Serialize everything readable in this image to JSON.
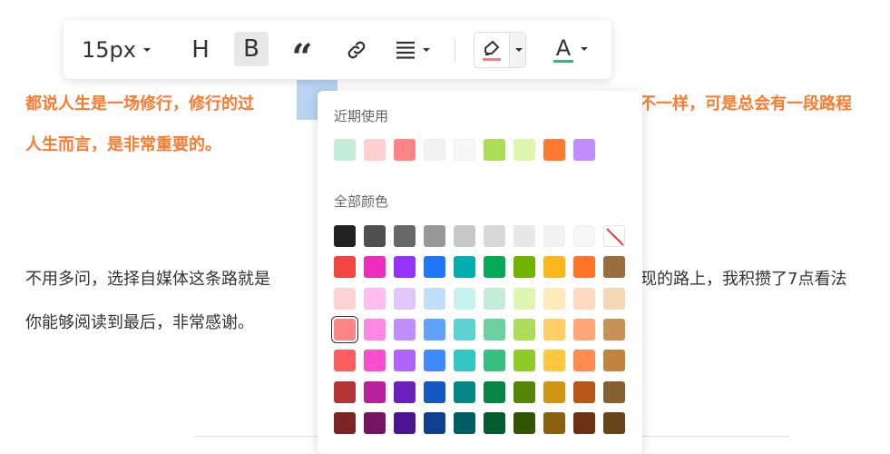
{
  "editor": {
    "heading_line1_left": "都说人生是一场修行，修行的过",
    "heading_line1_right": "不一样，可是总会有一段路程",
    "heading_line2": "人生而言，是非常重要的。",
    "body_line1_left": "不用多问，选择自媒体这条路就是",
    "body_line1_right": "现的路上，我积攒了7点看法",
    "body_line2": "你能够阅读到最后，非常感谢。",
    "heading_color": "#ff7a2f"
  },
  "toolbar": {
    "font_size": "15px",
    "heading": "H",
    "bold": "B",
    "font_color_letter": "A",
    "highlight_underline_color": "#f08080",
    "font_color_underline": "#3cb371"
  },
  "color_picker": {
    "recent_label": "近期使用",
    "all_label": "全部颜色",
    "recent": [
      "#c3ecd9",
      "#ffd0d0",
      "#ff8585",
      "#f2f2f2",
      "#f7f7f7",
      "#acdd58",
      "#def6ae",
      "#ff7a2f",
      "#c18cfc"
    ],
    "selected": "#ff8585",
    "rows": [
      [
        "#222222",
        "#4f4f4f",
        "#686868",
        "#999999",
        "#c7c7c7",
        "#d8d8d8",
        "#e8e8e8",
        "#f2f2f2",
        "#f7f7f7",
        "none"
      ],
      [
        "#f34444",
        "#ec2dbd",
        "#9632fc",
        "#1f76fb",
        "#03aeb0",
        "#04aa56",
        "#72b300",
        "#feb71a",
        "#ff7429",
        "#9a6d3e"
      ],
      [
        "#ffd3d3",
        "#ffbcef",
        "#e2c7ff",
        "#c1dff6",
        "#c8f2f0",
        "#c4ecd9",
        "#def6b2",
        "#feeabb",
        "#fed9c2",
        "#f4d8b5"
      ],
      [
        "#ff8585",
        "#fe88e4",
        "#c18cfc",
        "#5ea1ff",
        "#5dd2d3",
        "#6dd09f",
        "#acdd58",
        "#fed063",
        "#ffa676",
        "#c89257"
      ],
      [
        "#fd5e5e",
        "#f84fd1",
        "#af64fc",
        "#3f8bfd",
        "#33c6c4",
        "#36bf7e",
        "#8fcb27",
        "#fec73e",
        "#ff8b4f",
        "#c0843c"
      ],
      [
        "#b53434",
        "#b7219b",
        "#6b1fbb",
        "#1558c0",
        "#058787",
        "#068644",
        "#538603",
        "#cf9611",
        "#b85818",
        "#87602f"
      ],
      [
        "#7b2626",
        "#731560",
        "#4b1591",
        "#0f3f8f",
        "#005e60",
        "#045b30",
        "#335503",
        "#896110",
        "#6b3213",
        "#67441a"
      ]
    ]
  }
}
